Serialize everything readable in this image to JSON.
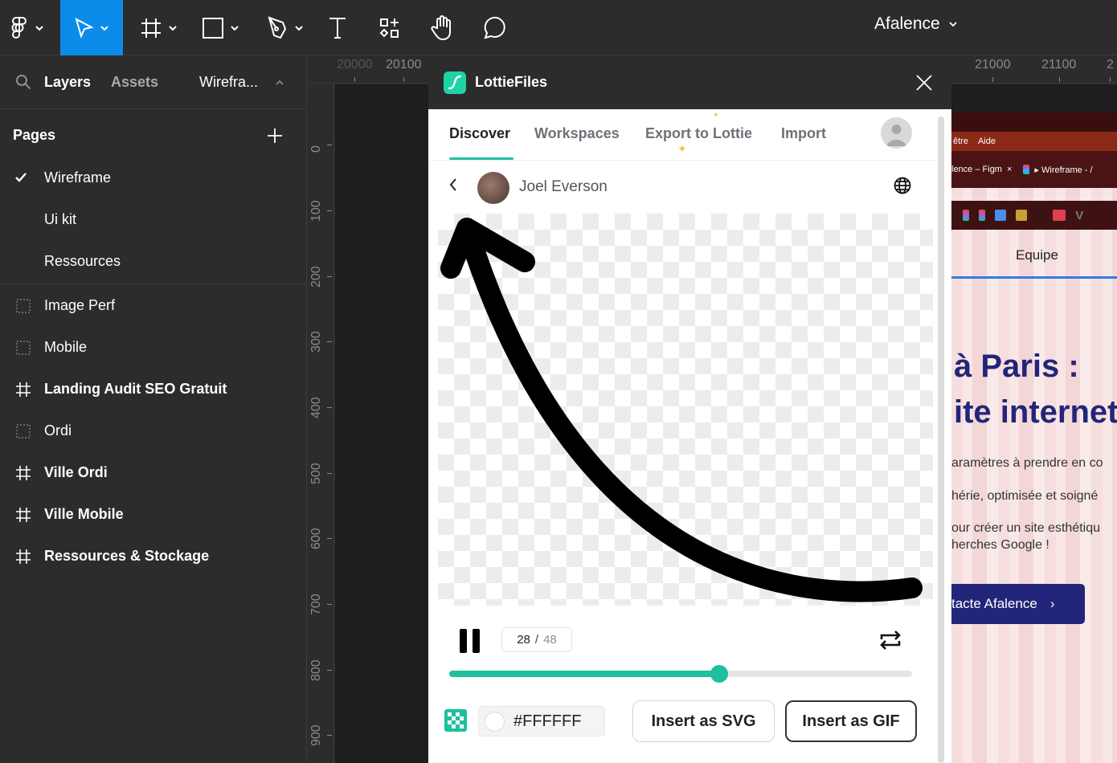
{
  "toolbar": {
    "tools": [
      {
        "name": "main-menu",
        "icon": "figma-logo-icon",
        "has_dropdown": true
      },
      {
        "name": "move",
        "icon": "cursor-arrow-icon",
        "has_dropdown": true,
        "active": true
      },
      {
        "name": "frame",
        "icon": "frame-hash-icon",
        "has_dropdown": true
      },
      {
        "name": "shape",
        "icon": "rectangle-icon",
        "has_dropdown": true
      },
      {
        "name": "pen",
        "icon": "pen-icon",
        "has_dropdown": true
      },
      {
        "name": "text",
        "icon": "text-icon",
        "has_dropdown": false
      },
      {
        "name": "resources",
        "icon": "resources-icon",
        "has_dropdown": false
      },
      {
        "name": "hand",
        "icon": "hand-icon",
        "has_dropdown": false
      },
      {
        "name": "comment",
        "icon": "comment-icon",
        "has_dropdown": false
      }
    ],
    "active_color": "#0c8ce9",
    "file_name": "Afalence"
  },
  "left_panel": {
    "tabs": {
      "layers": "Layers",
      "assets": "Assets",
      "page_selector": "Wirefra..."
    },
    "pages_title": "Pages",
    "pages": [
      {
        "label": "Wireframe",
        "current": true
      },
      {
        "label": "Ui kit",
        "current": false
      },
      {
        "label": "Ressources",
        "current": false
      }
    ],
    "layers": [
      {
        "label": "Image Perf",
        "type": "section",
        "bold": false
      },
      {
        "label": "Mobile",
        "type": "section",
        "bold": false
      },
      {
        "label": "Landing Audit SEO Gratuit",
        "type": "frame",
        "bold": true
      },
      {
        "label": "Ordi",
        "type": "section",
        "bold": false
      },
      {
        "label": "Ville Ordi",
        "type": "frame",
        "bold": true
      },
      {
        "label": "Ville Mobile",
        "type": "frame",
        "bold": true
      },
      {
        "label": "Ressources & Stockage",
        "type": "frame",
        "bold": true
      }
    ]
  },
  "rulers": {
    "horizontal": [
      "20000",
      "20100",
      "21000",
      "21100",
      "2"
    ],
    "vertical": [
      "0",
      "100",
      "200",
      "300",
      "400",
      "500",
      "600",
      "700",
      "800",
      "900"
    ]
  },
  "lottie": {
    "title": "LottieFiles",
    "brand_color": "#1ec09d",
    "tabs": [
      {
        "label": "Discover",
        "active": true
      },
      {
        "label": "Workspaces",
        "active": false
      },
      {
        "label": "Export to Lottie",
        "active": false
      },
      {
        "label": "Import",
        "active": false
      }
    ],
    "author": "Joel Everson",
    "player": {
      "current_frame": "28",
      "separator": "/",
      "total_frames": "48",
      "progress": 0.583,
      "state": "playing"
    },
    "background_color": "#FFFFFF",
    "insert_svg": "Insert as SVG",
    "insert_gif": "Insert as GIF"
  },
  "background_site": {
    "menu": [
      "être",
      "Aide"
    ],
    "tabs": [
      "lence – Figm",
      "▸ Wireframe - /"
    ],
    "nav": "Equipe",
    "heading_lines": [
      "à Paris :",
      "ite internet"
    ],
    "paragraphs": [
      "aramètres à prendre en co",
      "hérie, optimisée et soigné",
      "our créer un site esthétiqu",
      "herches Google !"
    ],
    "cta": "tacte Afalence",
    "cta_arrow": "›",
    "heading_color": "#23257a"
  }
}
